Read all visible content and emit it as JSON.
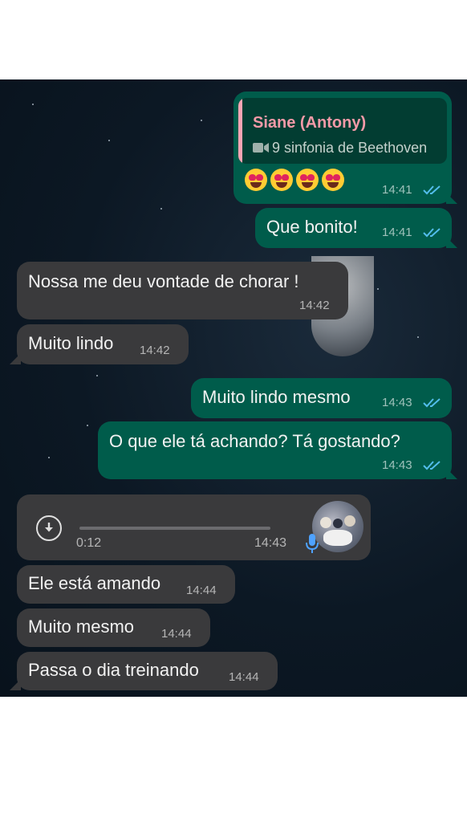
{
  "quoted": {
    "name": "Siane (Antony)",
    "subtitle": "9 sinfonia de Beethoven",
    "icon": "video-camera-icon"
  },
  "colors": {
    "outgoing": "#005c4b",
    "incoming": "#3a3a3c",
    "quote_accent": "#f59aa8",
    "read_ticks": "#53bdeb"
  },
  "messages": [
    {
      "dir": "out",
      "emojis": "😍😍😍😍",
      "time": "14:41",
      "status": "read"
    },
    {
      "dir": "out",
      "text": "Que bonito!",
      "time": "14:41",
      "status": "read"
    },
    {
      "dir": "in",
      "text": "Nossa me deu vontade de chorar !",
      "time": "14:42"
    },
    {
      "dir": "in",
      "text": "Muito lindo",
      "time": "14:42"
    },
    {
      "dir": "out",
      "text": "Muito lindo mesmo",
      "time": "14:43",
      "status": "read"
    },
    {
      "dir": "out",
      "text": "O que ele tá achando? Tá gostando?",
      "time": "14:43",
      "status": "read"
    },
    {
      "dir": "in",
      "type": "voice",
      "duration": "0:12",
      "time": "14:43"
    },
    {
      "dir": "in",
      "text": "Ele está amando",
      "time": "14:44"
    },
    {
      "dir": "in",
      "text": "Muito mesmo",
      "time": "14:44"
    },
    {
      "dir": "in",
      "text": "Passa o dia treinando",
      "time": "14:44"
    }
  ]
}
